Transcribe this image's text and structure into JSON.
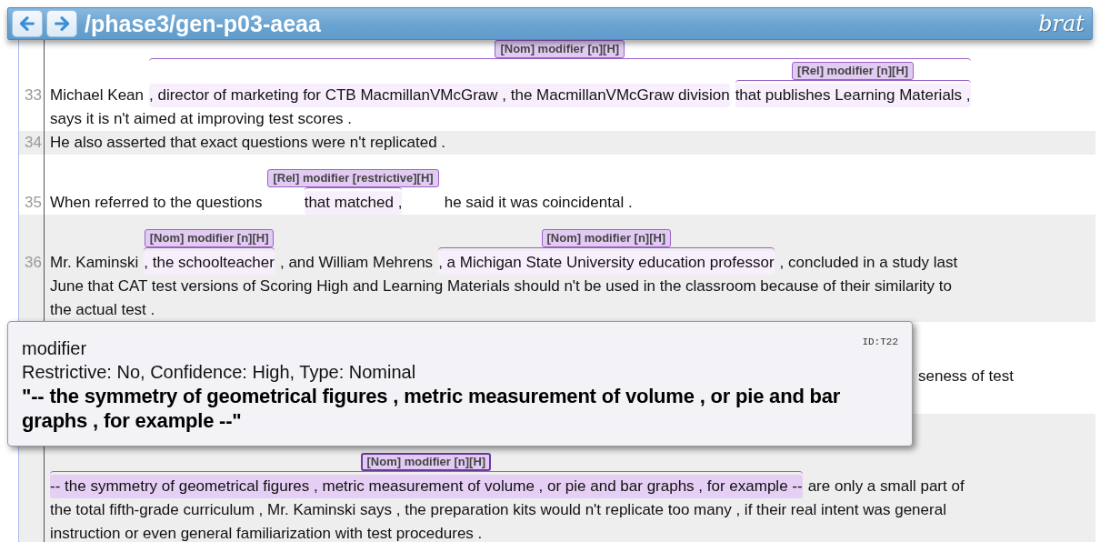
{
  "header": {
    "title": "/phase3/gen-p03-aeaa",
    "logo": "brat",
    "buttons": [
      {
        "kind": "back"
      },
      {
        "kind": "forward"
      }
    ]
  },
  "rows": [
    {
      "number": "33",
      "covered": false,
      "lines": [
        [
          {
            "kind": "text",
            "text": "Michael Kean"
          },
          {
            "kind": "span",
            "label": "[Nom] modifier [n][H]",
            "highlighted": false,
            "parts": [
              {
                "kind": "text",
                "text": ", director of marketing for CTB MacmillanVMcGraw , the MacmillanVMcGraw division"
              },
              {
                "kind": "span",
                "label": "[Rel] modifier [n][H]",
                "highlighted": false,
                "parts": [
                  {
                    "kind": "text",
                    "text": "that publishes Learning Materials ,"
                  }
                ]
              }
            ]
          }
        ],
        [
          {
            "kind": "text",
            "text": "says it is n't aimed at improving test scores ."
          }
        ]
      ]
    },
    {
      "number": "34",
      "covered": false,
      "lines": [
        [
          {
            "kind": "text",
            "text": "He also asserted that exact questions were n't replicated ."
          }
        ]
      ]
    },
    {
      "number": "35",
      "covered": false,
      "lines": [
        [
          {
            "kind": "text",
            "text": "When referred to the questions"
          },
          {
            "kind": "span",
            "label": "[Rel] modifier [restrictive][H]",
            "highlighted": false,
            "parts": [
              {
                "kind": "text",
                "text": "that matched ,"
              }
            ]
          },
          {
            "kind": "text",
            "text": "he said it was coincidental ."
          }
        ]
      ]
    },
    {
      "number": "36",
      "covered": false,
      "lines": [
        [
          {
            "kind": "text",
            "text": "Mr. Kaminski"
          },
          {
            "kind": "span",
            "label": "[Nom] modifier [n][H]",
            "highlighted": false,
            "parts": [
              {
                "kind": "text",
                "text": ", the schoolteacher"
              }
            ]
          },
          {
            "kind": "text",
            "text": ", and William Mehrens"
          },
          {
            "kind": "span",
            "label": "[Nom] modifier [n][H]",
            "highlighted": false,
            "parts": [
              {
                "kind": "text",
                "text": ", a Michigan State University education professor"
              }
            ]
          },
          {
            "kind": "text",
            "text": ", concluded in a study last"
          }
        ],
        [
          {
            "kind": "text",
            "text": "June that CAT test versions of Scoring High and Learning Materials should n't be used in the classroom because of their similarity to"
          }
        ],
        [
          {
            "kind": "text",
            "text": "the actual test ."
          }
        ]
      ]
    },
    {
      "covered": true,
      "lines": [
        [
          {
            "kind": "fragment",
            "text": "seness of test"
          }
        ]
      ]
    },
    {
      "covered": true,
      "lines": [
        [
          {
            "kind": "span",
            "label": "[Nom] modifier [n][H]",
            "highlighted": true,
            "parts": [
              {
                "kind": "text",
                "text": "-- the symmetry of geometrical figures , metric measurement of volume , or pie and bar graphs , for example --"
              }
            ]
          },
          {
            "kind": "text",
            "text": "are only a small part of"
          }
        ],
        [
          {
            "kind": "text",
            "text": "the total fifth-grade curriculum , Mr. Kaminski says , the preparation kits would n't replicate too many , if their real intent was general"
          }
        ],
        [
          {
            "kind": "text",
            "text": "instruction or even general familiarization with test procedures ."
          }
        ]
      ]
    }
  ],
  "tooltip": {
    "type": "modifier",
    "attributes": "Restrictive: No, Confidence: High, Type: Nominal",
    "quote": "\"-- the symmetry of geometrical figures , metric measurement of volume , or pie and bar graphs , for example --\"",
    "id": "ID:T22"
  }
}
